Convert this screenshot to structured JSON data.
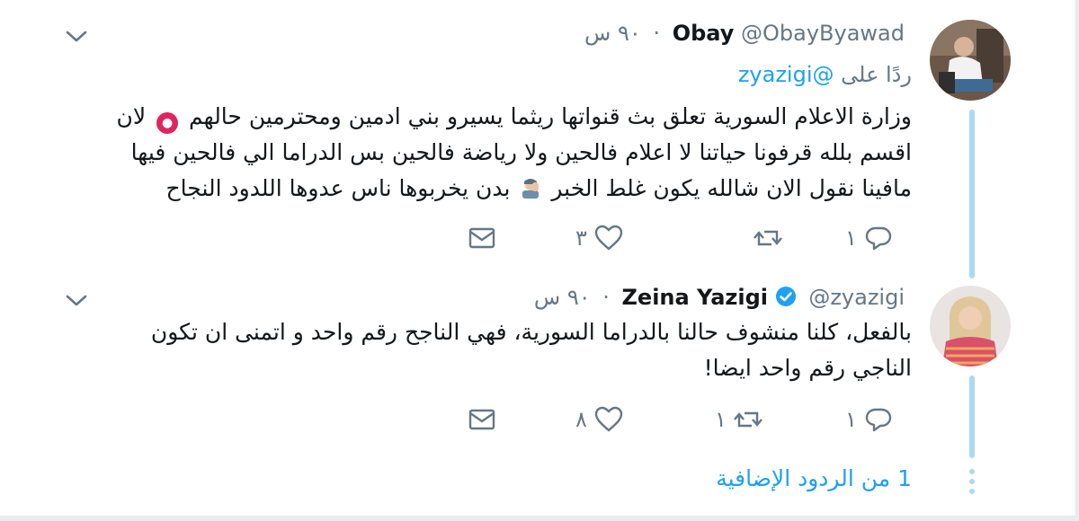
{
  "tweets": [
    {
      "name": "Obay",
      "handle": "@ObayByawad",
      "dot": "·",
      "time": "٩٠ س",
      "replying_prefix": "ردًا على",
      "replying_to": "@zyazigi",
      "text_line1": "وزارة الاعلام السورية تعلق بث قنواتها ريثما يسيرو بني ادمين ومحترمين حالهم",
      "text_line1_end": "لان",
      "text_line2": "اقسم بلله قرفونا حياتنا لا اعلام فالحين ولا رياضة فالحين بس الدراما الي فالحين فيها",
      "text_line3_a": "بدن يخربوها ناس عدوها اللدود النجاح",
      "text_line3_b": "مافينا نقول الان شالله يكون غلط الخبر",
      "reply_count": "١",
      "retweet_count": "",
      "like_count": "٣"
    },
    {
      "name": "Zeina Yazigi",
      "handle": "@zyazigi",
      "dot": "·",
      "time": "٩٠ س",
      "text_line1": "بالفعل، كلنا منشوف حالنا بالدراما السورية، فهي الناجح رقم واحد و اتمنى ان تكون",
      "text_line2": "الناجي رقم واحد ايضا!",
      "reply_count": "١",
      "retweet_count": "١",
      "like_count": "٨"
    }
  ],
  "more_replies": "1 من الردود الإضافية",
  "colors": {
    "accent": "#1da1f2",
    "thread": "#a9d9f7",
    "muted": "#657786",
    "text": "#14171a"
  },
  "icons": [
    "chevron-down-icon",
    "reply-icon",
    "retweet-icon",
    "like-icon",
    "message-icon",
    "verified-icon"
  ]
}
